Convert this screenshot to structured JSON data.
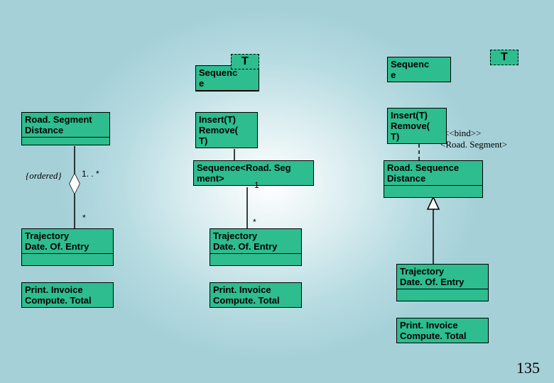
{
  "column1": {
    "roadSegment": {
      "line1": "Road. Segment",
      "line2": "Distance"
    },
    "ordered": "{ordered}",
    "mult1": "1. . *",
    "mult2": "*",
    "trajectory": {
      "line1": "Trajectory",
      "line2": "Date. Of. Entry"
    },
    "methods": {
      "line1": "Print. Invoice",
      "line2": "Compute. Total"
    }
  },
  "column2": {
    "templateParam": "T",
    "sequence": "Sequenc\ne",
    "ops": "Insert(T)\nRemove(\nT)",
    "seqBound": "Sequence<Road. Seg\nment>",
    "mult1": "1",
    "mult2": "*",
    "trajectory": {
      "line1": "Trajectory",
      "line2": "Date. Of. Entry"
    },
    "methods": {
      "line1": "Print. Invoice",
      "line2": "Compute. Total"
    }
  },
  "column3": {
    "templateParam": "T",
    "sequence": "Sequenc\ne",
    "ops": "Insert(T)\nRemove(\nT)",
    "bindText1": "<<bind>>",
    "bindText2": "<Road. Segment>",
    "roadSeq": {
      "line1": "Road. Sequence",
      "line2": "Distance"
    },
    "trajectory": {
      "line1": "Trajectory",
      "line2": "Date. Of. Entry"
    },
    "methods": {
      "line1": "Print. Invoice",
      "line2": "Compute. Total"
    }
  },
  "pageNumber": "135"
}
